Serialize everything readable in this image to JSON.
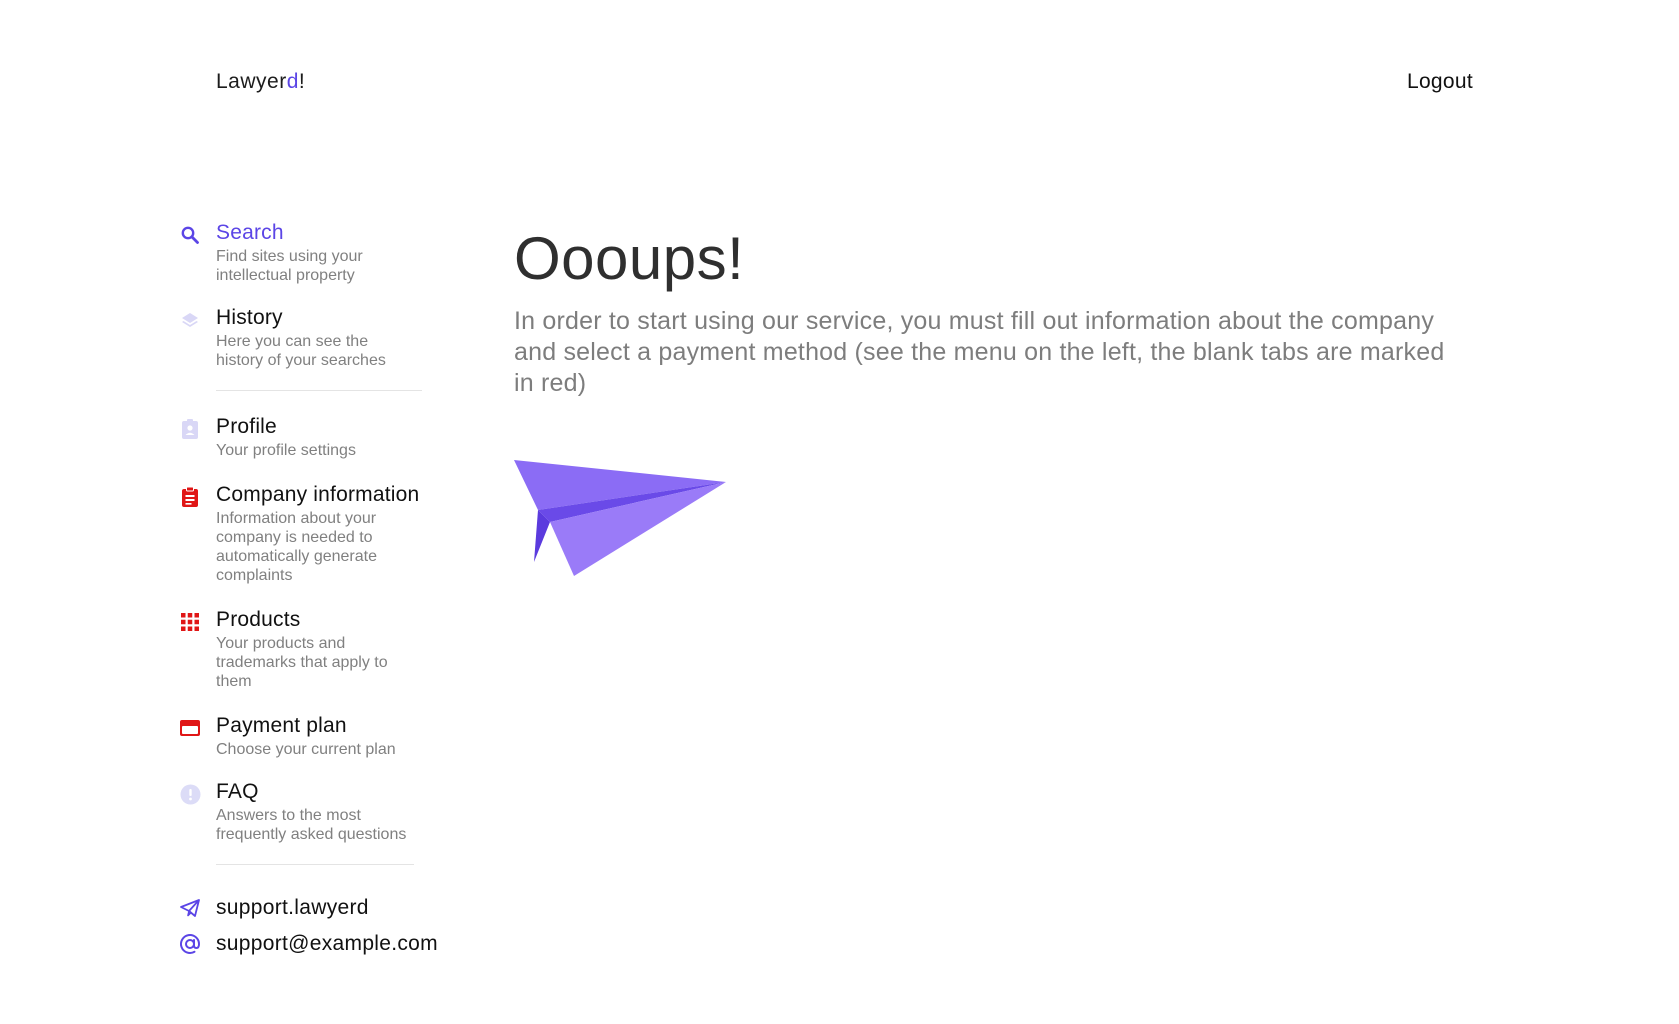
{
  "header": {
    "logo_main": "Lawyer",
    "logo_accent": "d",
    "logo_suffix": "!",
    "logout_label": "Logout"
  },
  "sidebar": {
    "items": [
      {
        "title": "Search",
        "description": "Find sites using your intellectual property",
        "icon": "search-icon",
        "state": "active"
      },
      {
        "title": "History",
        "description": "Here you can see the history of your searches",
        "icon": "layers-icon",
        "state": "normal"
      },
      {
        "title": "Profile",
        "description": "Your profile settings",
        "icon": "id-badge-icon",
        "state": "normal"
      },
      {
        "title": "Company information",
        "description": "Information about your company is needed to automatically generate complaints",
        "icon": "clipboard-icon",
        "state": "incomplete"
      },
      {
        "title": "Products",
        "description": "Your products and trademarks that apply to them",
        "icon": "grid-icon",
        "state": "incomplete"
      },
      {
        "title": "Payment plan",
        "description": "Choose your current plan",
        "icon": "credit-card-icon",
        "state": "incomplete"
      },
      {
        "title": "FAQ",
        "description": "Answers to the most frequently asked questions",
        "icon": "info-circle-icon",
        "state": "normal"
      }
    ],
    "contacts": [
      {
        "label": "support.lawyerd",
        "icon": "telegram-icon"
      },
      {
        "label": "support@example.com",
        "icon": "at-sign-icon"
      }
    ]
  },
  "main": {
    "title": "Oooups!",
    "message": "In order to start using our service, you must fill out information about the company and select a payment method (see the menu on the left, the blank tabs are marked in red)",
    "illustration": "paper-plane-icon"
  },
  "colors": {
    "accent": "#5b45e6",
    "incomplete": "#e01616",
    "muted_icon": "#dcdcf7",
    "text_muted": "#808080"
  }
}
